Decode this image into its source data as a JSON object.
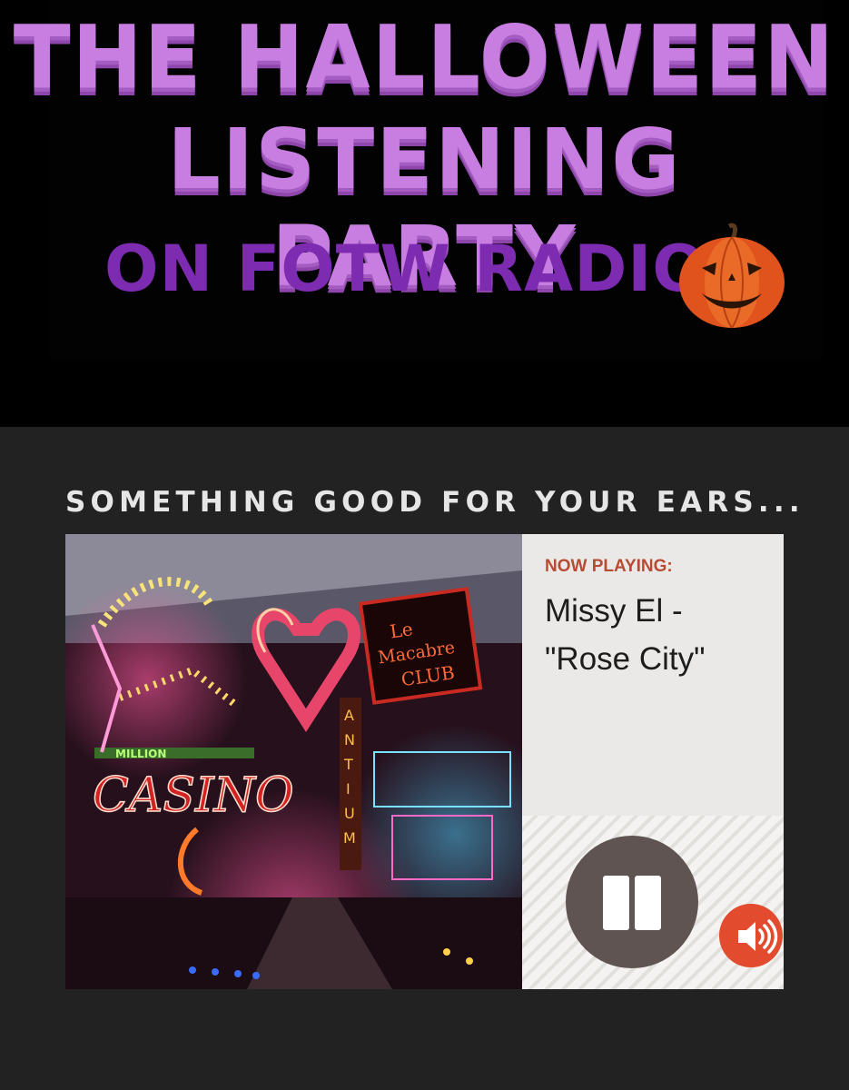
{
  "banner": {
    "line1": "THE HALLOWEEN",
    "line2": "LISTENING PARTY",
    "line3": "ON FOTW RADIO"
  },
  "section": {
    "heading": "SOMETHING GOOD FOR YOUR EARS..."
  },
  "player": {
    "now_playing_label": "NOW PLAYING:",
    "track_artist_line": "Missy El -",
    "track_title_line": "\"Rose City\"",
    "pause_icon": "pause-icon",
    "volume_icon": "speaker-volume-icon",
    "accent_color": "#e24b2d",
    "label_color": "#b84b33"
  },
  "cover_art": {
    "signs": [
      "Le Macabre CLUB",
      "CASINO",
      "ANTIUM",
      "MILLION"
    ]
  }
}
